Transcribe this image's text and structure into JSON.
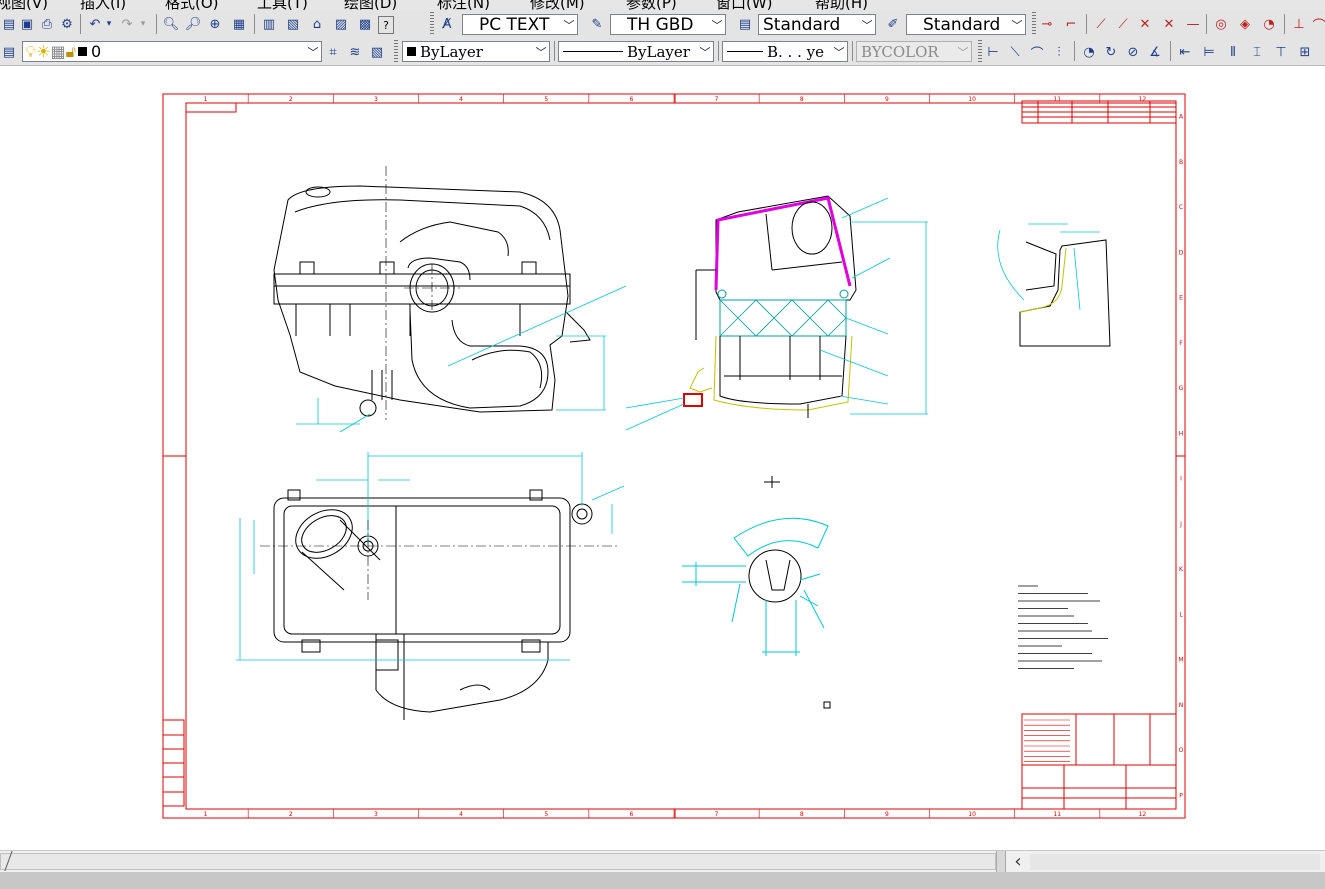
{
  "menu": {
    "items": [
      "视图(V)",
      "插入(I)",
      "格式(O)",
      "工具(T)",
      "绘图(D)",
      "标注(N)",
      "修改(M)",
      "参数(P)",
      "窗口(W)",
      "帮助(H)"
    ]
  },
  "styles": {
    "text_style": "PC TEXT",
    "dim_style": "TH GBD",
    "table_style": "Standard",
    "multileader_style": "Standard"
  },
  "layers": {
    "current_layer": "0",
    "color": "ByLayer",
    "linetype": "ByLayer",
    "lineweight": "B. . . ye",
    "plot_style": "BYCOLOR"
  },
  "drawing": {
    "column_numbers": [
      "1",
      "2",
      "3",
      "4",
      "5",
      "6",
      "7",
      "8",
      "9",
      "10",
      "11",
      "12"
    ],
    "row_letters": [
      "A",
      "B",
      "C",
      "D",
      "E",
      "F",
      "G",
      "H",
      "I",
      "J",
      "K",
      "L",
      "M",
      "N",
      "O",
      "P"
    ],
    "colors": {
      "frame": "#e00000",
      "dimension": "#00c8d8",
      "part": "#000000",
      "seal": "#e000e0",
      "filter": "#00a0a0",
      "housing": "#c8c000"
    }
  },
  "scrollbar": {
    "arrow": "‹"
  }
}
